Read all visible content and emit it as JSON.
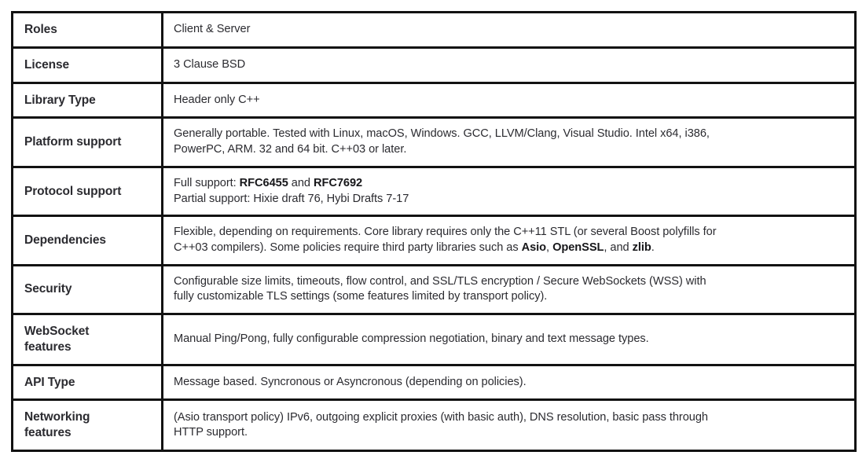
{
  "table": {
    "rows": [
      {
        "label": "Roles",
        "label_lines": [
          "Roles"
        ],
        "lines": [
          [
            {
              "t": "Client & Server",
              "b": false
            }
          ]
        ]
      },
      {
        "label": "License",
        "label_lines": [
          "License"
        ],
        "lines": [
          [
            {
              "t": "3 Clause BSD",
              "b": false
            }
          ]
        ]
      },
      {
        "label": "Library Type",
        "label_lines": [
          "Library Type"
        ],
        "lines": [
          [
            {
              "t": "Header only C++",
              "b": false
            }
          ]
        ]
      },
      {
        "label": "Platform support",
        "label_lines": [
          "Platform support"
        ],
        "lines": [
          [
            {
              "t": "Generally portable. Tested with Linux, macOS, Windows. GCC, LLVM/Clang, Visual Studio. Intel x64, i386,",
              "b": false
            }
          ],
          [
            {
              "t": "PowerPC, ARM. 32 and 64 bit. C++03 or later.",
              "b": false
            }
          ]
        ]
      },
      {
        "label": "Protocol support",
        "label_lines": [
          "Protocol support"
        ],
        "lines": [
          [
            {
              "t": "Full support: ",
              "b": false
            },
            {
              "t": "RFC6455",
              "b": true
            },
            {
              "t": " and ",
              "b": false
            },
            {
              "t": "RFC7692",
              "b": true
            }
          ],
          [
            {
              "t": "Partial support: Hixie draft 76, Hybi Drafts 7-17",
              "b": false
            }
          ]
        ]
      },
      {
        "label": "Dependencies",
        "label_lines": [
          "Dependencies"
        ],
        "lines": [
          [
            {
              "t": "Flexible, depending on requirements. Core library requires only the C++11 STL (or several Boost polyfills for",
              "b": false
            }
          ],
          [
            {
              "t": "C++03 compilers). Some policies require third party libraries such as ",
              "b": false
            },
            {
              "t": "Asio",
              "b": true
            },
            {
              "t": ", ",
              "b": false
            },
            {
              "t": "OpenSSL",
              "b": true
            },
            {
              "t": ", and ",
              "b": false
            },
            {
              "t": "zlib",
              "b": true
            },
            {
              "t": ".",
              "b": false
            }
          ]
        ]
      },
      {
        "label": "Security",
        "label_lines": [
          "Security"
        ],
        "lines": [
          [
            {
              "t": "Configurable size limits, timeouts, flow control, and SSL/TLS encryption / Secure WebSockets (WSS) with",
              "b": false
            }
          ],
          [
            {
              "t": "fully customizable TLS settings (some features limited by transport policy).",
              "b": false
            }
          ]
        ]
      },
      {
        "label": "WebSocket features",
        "label_lines": [
          "WebSocket",
          "features"
        ],
        "lines": [
          [
            {
              "t": "Manual Ping/Pong, fully configurable compression negotiation, binary and text message types.",
              "b": false
            }
          ]
        ]
      },
      {
        "label": "API Type",
        "label_lines": [
          "API Type"
        ],
        "lines": [
          [
            {
              "t": "Message based. Syncronous or Asyncronous (depending on policies).",
              "b": false
            }
          ]
        ]
      },
      {
        "label": "Networking features",
        "label_lines": [
          "Networking",
          "features"
        ],
        "lines": [
          [
            {
              "t": "(Asio transport policy) IPv6, outgoing explicit proxies (with basic auth), DNS resolution, basic pass through",
              "b": false
            }
          ],
          [
            {
              "t": "HTTP support.",
              "b": false
            }
          ]
        ]
      }
    ]
  }
}
